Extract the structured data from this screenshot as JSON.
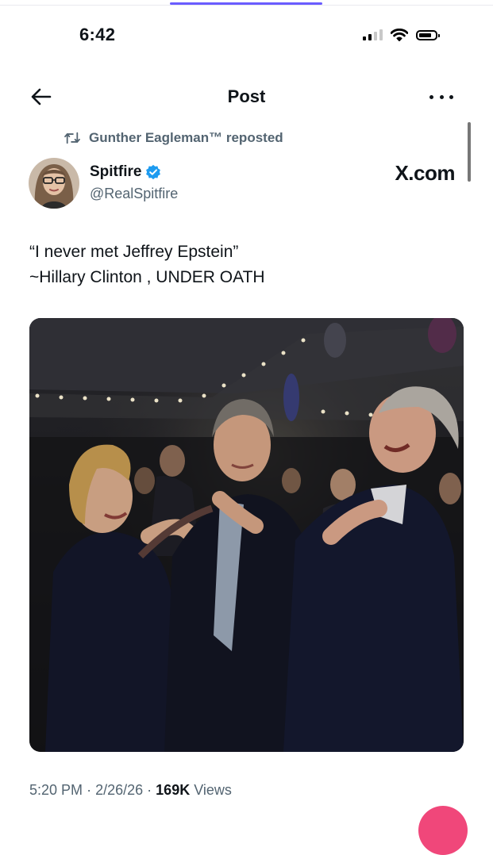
{
  "status_bar": {
    "time": "6:42",
    "icons": [
      "cellular-signal-icon",
      "wifi-icon",
      "battery-icon"
    ]
  },
  "header": {
    "title": "Post",
    "back_icon": "arrow-left-icon",
    "more_icon": "more-horizontal-icon"
  },
  "repost": {
    "text": "Gunther Eagleman™ reposted",
    "icon": "repost-icon"
  },
  "author": {
    "name": "Spitfire",
    "handle": "@RealSpitfire",
    "verified": true,
    "verified_color": "#1d9bf0"
  },
  "source_label": "X.com",
  "post": {
    "line1": "“I never met Jeffrey Epstein”",
    "line2": "~Hillary Clinton , UNDER OATH"
  },
  "meta": {
    "time": "5:20 PM",
    "separator": "·",
    "date": "2/26/26",
    "views_count": "169K",
    "views_label": "Views"
  },
  "colors": {
    "text_primary": "#0f1419",
    "text_secondary": "#536471",
    "progress_accent": "#6a5cff",
    "fab": "#f0477a"
  }
}
